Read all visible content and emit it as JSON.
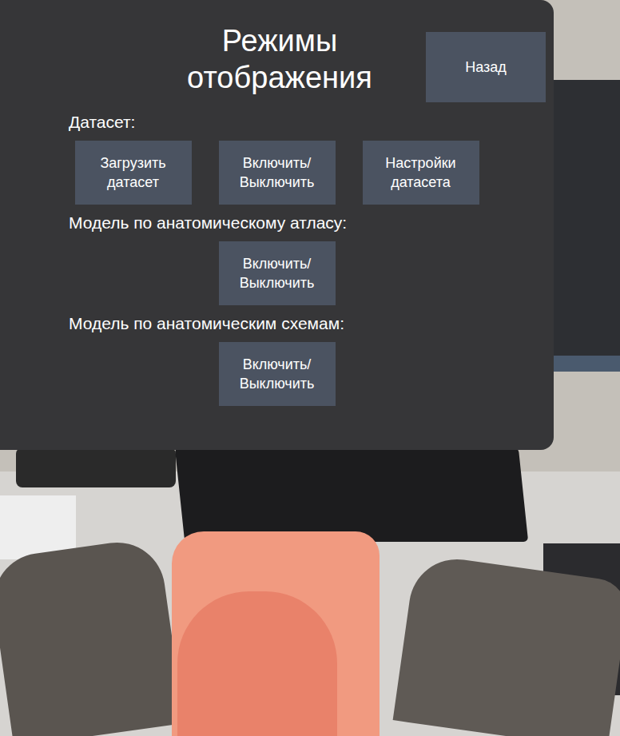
{
  "panel": {
    "title": "Режимы отображения",
    "back_button": "Назад"
  },
  "sections": [
    {
      "label": "Датасет:",
      "buttons": [
        "Загрузить датасет",
        "Включить/ Выключить",
        "Настройки датасета"
      ]
    },
    {
      "label": "Модель по анатомическому атласу:",
      "buttons": [
        "Включить/ Выключить"
      ]
    },
    {
      "label": "Модель по анатомическим схемам:",
      "buttons": [
        "Включить/ Выключить"
      ]
    }
  ]
}
